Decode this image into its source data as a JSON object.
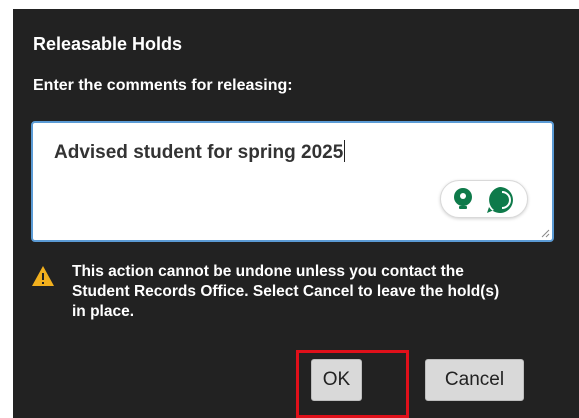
{
  "dialog": {
    "title": "Releasable Holds",
    "prompt": "Enter the comments for releasing:",
    "comment_value": "Advised student for spring 2025",
    "warning": "This action cannot be undone unless you contact the Student Records Office. Select Cancel to leave the hold(s) in place.",
    "ok_label": "OK",
    "cancel_label": "Cancel"
  },
  "icons": {
    "assist": "lightbulb-icon",
    "chat": "chat-bubble-icon",
    "warning": "warning-triangle-icon",
    "resize": "resize-grip-icon"
  },
  "colors": {
    "dialog_background": "#222222",
    "input_border": "#5b9bd5",
    "warning": "#f2b01e",
    "assist_green": "#0e7a4a",
    "highlight": "#e0101a"
  }
}
